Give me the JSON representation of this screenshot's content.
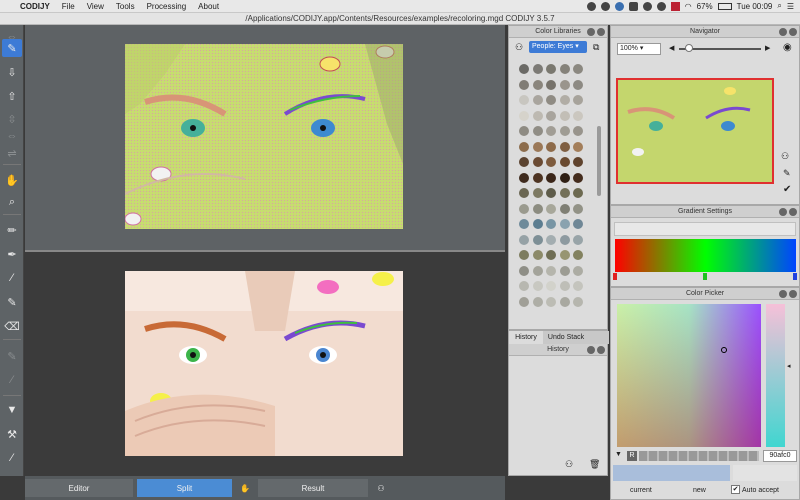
{
  "menubar": {
    "app_name": "CODIJY",
    "menus": [
      "File",
      "View",
      "Tools",
      "Processing",
      "About"
    ],
    "battery": "67%",
    "clock": "Tue 00:09"
  },
  "window": {
    "title": "/Applications/CODIJY.app/Contents/Resources/examples/recoloring.mgd CODIJY 3.5.7"
  },
  "bottombar": {
    "editor_label": "Editor",
    "split_label": "Split",
    "result_label": "Result"
  },
  "color_libraries": {
    "title": "Color Libraries",
    "selected_library": "People: Eyes",
    "tabs": [
      "History",
      "Undo Stack"
    ],
    "history_title": "History",
    "swatch_rows": [
      [
        "#6b6a66",
        "#7c7a75",
        "#7a786f",
        "#85827a",
        "#8b8880"
      ],
      [
        "#807c75",
        "#8a857c",
        "#77736b",
        "#9a958c",
        "#8d8a83"
      ],
      [
        "#c8c6c0",
        "#a9a59e",
        "#8f8b83",
        "#b1ada5",
        "#a7a39b"
      ],
      [
        "#d6d3cb",
        "#bdb9b1",
        "#a8a49d",
        "#c2beb6",
        "#cbc7bf"
      ],
      [
        "#8e8b83",
        "#908d85",
        "#a19d95",
        "#9f9c94",
        "#98948c"
      ],
      [
        "#8c6c4c",
        "#9b7857",
        "#8e6b4a",
        "#7f5f42",
        "#a37e5a"
      ],
      [
        "#5b4330",
        "#6b4b33",
        "#7e5b3d",
        "#6a4a30",
        "#5f432d"
      ],
      [
        "#3f2b1e",
        "#4e3422",
        "#3b2619",
        "#2f1f14",
        "#442c1d"
      ],
      [
        "#6a6652",
        "#7d7962",
        "#5e5c4a",
        "#737058",
        "#6c6950"
      ],
      [
        "#9a9a8e",
        "#8c8c80",
        "#a7a79a",
        "#7f7f74",
        "#929286"
      ],
      [
        "#6e8a9a",
        "#5c7d90",
        "#7895a4",
        "#8aa2af",
        "#6f8796"
      ],
      [
        "#96a2a6",
        "#7d8f96",
        "#a3adb0",
        "#8d9aa0",
        "#98a4a8"
      ],
      [
        "#7d7c5e",
        "#8c8a68",
        "#6f6e54",
        "#979571",
        "#83825f"
      ],
      [
        "#8e8e86",
        "#a3a39a",
        "#b5b5ac",
        "#9c9c93",
        "#acaca3"
      ],
      [
        "#b7b7b0",
        "#c8c8c1",
        "#d2d2cb",
        "#bebeb7",
        "#c4c4bd"
      ],
      [
        "#a09f97",
        "#aeaea6",
        "#bcbcb4",
        "#a8a8a0",
        "#b6b6ae"
      ]
    ]
  },
  "navigator": {
    "title": "Navigator",
    "zoom": "100%"
  },
  "gradient_settings": {
    "title": "Gradient Settings"
  },
  "color_picker": {
    "title": "Color Picker",
    "channel_letter": "R",
    "hex_value": "90afc0",
    "current_label": "current",
    "new_label": "new",
    "auto_accept_label": "Auto accept",
    "auto_accept_checked": true
  },
  "colors": {
    "accent": "#3d7bd6",
    "nav_border": "#e03030"
  }
}
